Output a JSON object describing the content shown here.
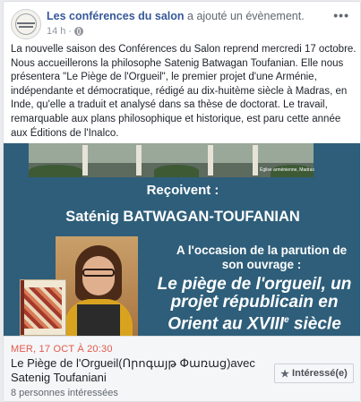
{
  "post": {
    "page_name": "Les conférences du salon",
    "action": "a ajouté un évènement.",
    "time": "14 h",
    "separator": "·",
    "more_label": "•••",
    "text": "La nouvelle saison des Conférences du Salon reprend mercredi 17 octobre. Nous accueillerons la philosophe Satenig Batwagan Toufanian. Elle nous présentera \"Le Piège de l'Orgueil\", le premier projet d'une Arménie, indépendante et démocratique, rédigé au dix-huitème siècle à Madras, en Inde, qu'elle a traduit et analysé dans sa thèse de doctorat. Le travail, remarquable aux plans philosophique et historique, est paru cette année aux Éditions de l'Inalco."
  },
  "banner": {
    "photo_caption": "Église arménienne, Madras",
    "recoivent": "Reçoivent :",
    "guest": "Saténig BATWAGAN-TOUFANIAN",
    "occasion": "A l'occasion de la parution de son ouvrage :",
    "book_title_main": "Le piège de l'orgueil, un projet républicain en Orient au XVIII",
    "book_title_sup": "e",
    "book_title_end": " siècle"
  },
  "event": {
    "date": "MER, 17 OCT À 20:30",
    "title": "Le Piège de l'Orgueil(Որոգայթ Փառաց)avec Satenig Toufaniani",
    "interested_count": "8 personnes intéressées",
    "interest_button_label": "Intéressé(e)",
    "interest_icon": "star-icon"
  },
  "colors": {
    "page_name": "#365899",
    "event_date": "#e4584e",
    "banner": "#2e5e7a"
  }
}
